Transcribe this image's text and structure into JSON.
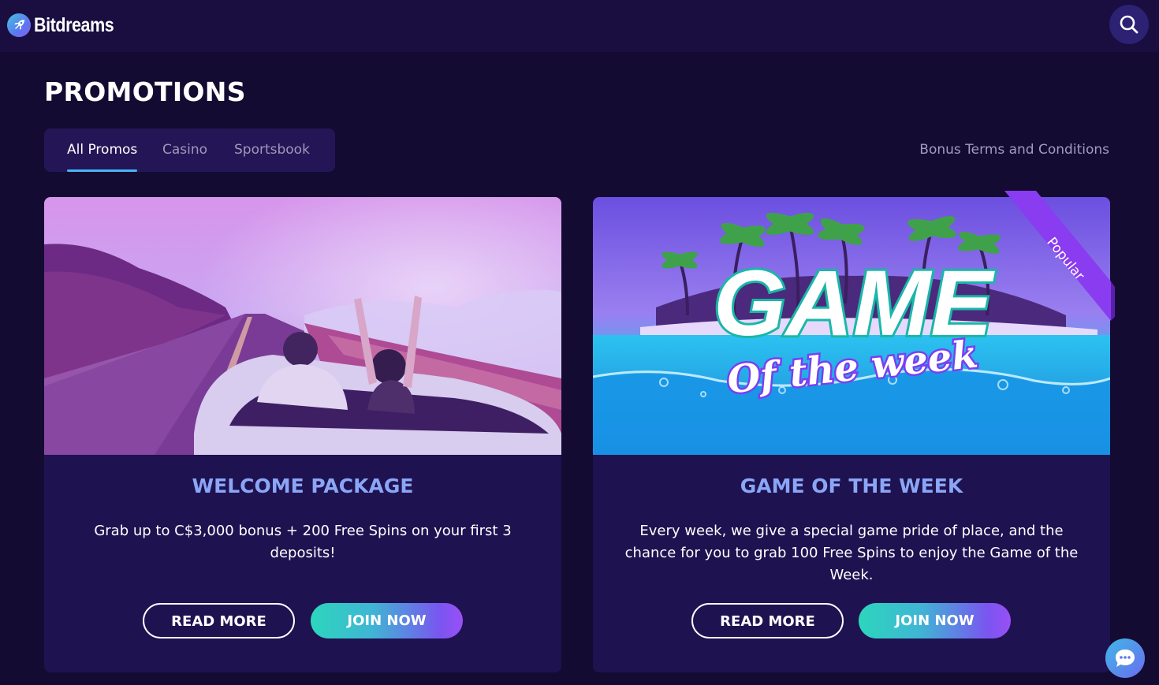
{
  "brand": {
    "name": "Bitdreams"
  },
  "header": {
    "search_icon": "search-icon"
  },
  "page": {
    "title": "PROMOTIONS"
  },
  "tabs": [
    {
      "label": "All Promos",
      "active": true
    },
    {
      "label": "Casino",
      "active": false
    },
    {
      "label": "Sportsbook",
      "active": false
    }
  ],
  "terms_link": "Bonus Terms and Conditions",
  "promos": [
    {
      "title": "WELCOME PACKAGE",
      "description": "Grab up to C$3,000 bonus + 200 Free Spins on your first 3 deposits!",
      "read_more": "READ MORE",
      "join_now": "JOIN NOW"
    },
    {
      "title": "GAME OF THE WEEK",
      "description": "Every week, we give a special game pride of place, and the chance for you to grab 100 Free Spins to enjoy the Game of the Week.",
      "read_more": "READ MORE",
      "join_now": "JOIN NOW",
      "badge": "Popular",
      "banner_title": "GAME",
      "banner_subtitle": "Of the week"
    }
  ],
  "chat": {
    "icon": "chat-bubble-icon"
  },
  "colors": {
    "background": "#140b33",
    "card": "#1f1250",
    "accent_title": "#8ba6f6",
    "ribbon": "#8a3cf0"
  }
}
